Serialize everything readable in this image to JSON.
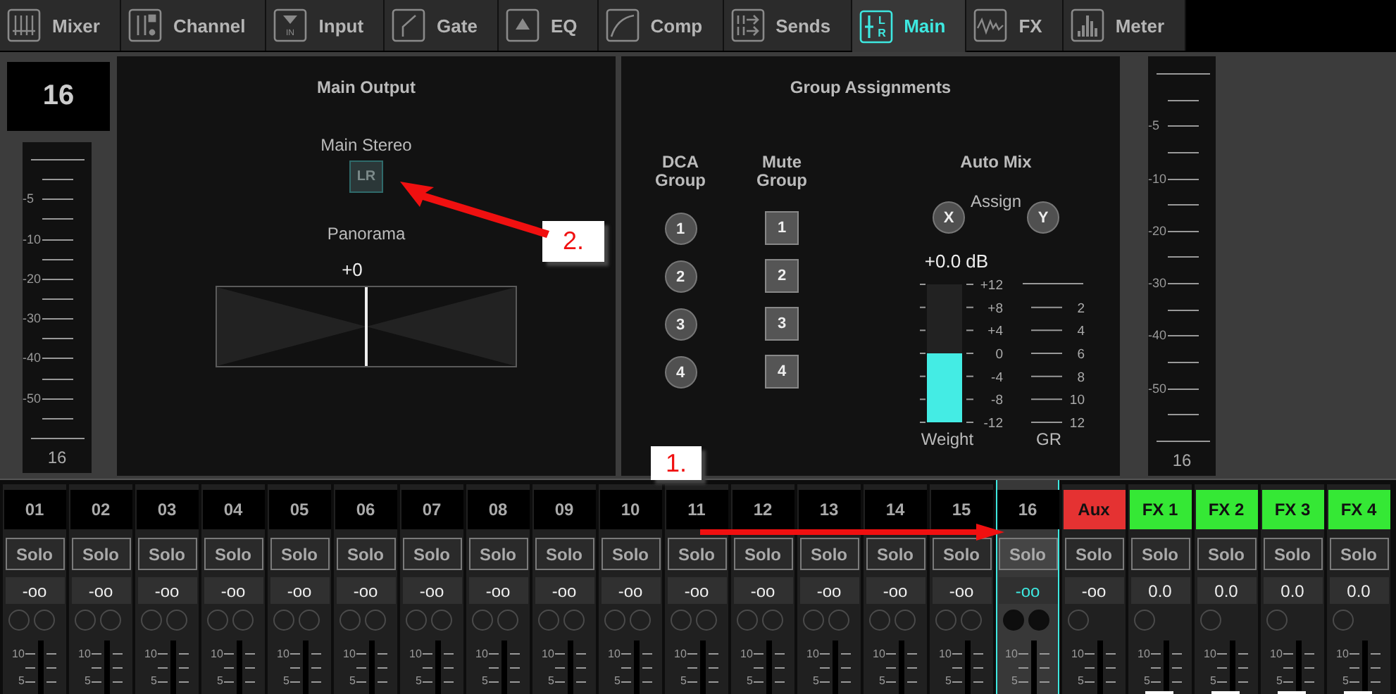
{
  "tabs": [
    {
      "label": "Mixer",
      "selected": false
    },
    {
      "label": "Channel",
      "selected": false
    },
    {
      "label": "Input",
      "selected": false,
      "icon_text": [
        "IN"
      ]
    },
    {
      "label": "Gate",
      "selected": false
    },
    {
      "label": "EQ",
      "selected": false
    },
    {
      "label": "Comp",
      "selected": false
    },
    {
      "label": "Sends",
      "selected": false
    },
    {
      "label": "Main",
      "selected": true,
      "icon_text": [
        "L",
        "R"
      ]
    },
    {
      "label": "FX",
      "selected": false
    },
    {
      "label": "Meter",
      "selected": false
    }
  ],
  "channel_display": "16",
  "left_meter": {
    "labels": [
      "-5",
      "-10",
      "-20",
      "-30",
      "-40",
      "-50"
    ],
    "channel": "16"
  },
  "main_output": {
    "title": "Main Output",
    "stereo_label": "Main Stereo",
    "stereo_button": {
      "label": "LR",
      "on": false
    },
    "panorama_label": "Panorama",
    "panorama_value": "+0",
    "panorama": {
      "level": 0.5
    }
  },
  "group_assignments": {
    "title": "Group Assignments",
    "dca": {
      "heading": "DCA Group",
      "buttons": [
        {
          "label": "1",
          "on": false
        },
        {
          "label": "2",
          "on": false
        },
        {
          "label": "3",
          "on": false
        },
        {
          "label": "4",
          "on": false
        }
      ]
    },
    "mute": {
      "heading": "Mute Group",
      "buttons": [
        {
          "label": "1",
          "on": false
        },
        {
          "label": "2",
          "on": false
        },
        {
          "label": "3",
          "on": false
        },
        {
          "label": "4",
          "on": false
        }
      ]
    },
    "auto_mix": {
      "heading": "Auto Mix",
      "assign_label": "Assign",
      "assign": [
        {
          "label": "X",
          "on": false
        },
        {
          "label": "Y",
          "on": false
        }
      ],
      "weight_value": "+0.0 dB",
      "weight": {
        "level": 0.5,
        "scale": [
          "+12",
          "+8",
          "+4",
          "0",
          "-4",
          "-8",
          "-12"
        ],
        "label": "Weight"
      },
      "gr": {
        "scale": [
          "2",
          "4",
          "6",
          "8",
          "10",
          "12"
        ],
        "label": "GR"
      }
    }
  },
  "right_meter": {
    "labels": [
      "-5",
      "-10",
      "-20",
      "-30",
      "-40",
      "-50"
    ],
    "channel": "16"
  },
  "strips": [
    {
      "name": "01",
      "kind": "channel",
      "selected": false,
      "solo": "Solo",
      "value": "-oo",
      "scale": [
        "10",
        "5"
      ]
    },
    {
      "name": "02",
      "kind": "channel",
      "selected": false,
      "solo": "Solo",
      "value": "-oo",
      "scale": [
        "10",
        "5"
      ]
    },
    {
      "name": "03",
      "kind": "channel",
      "selected": false,
      "solo": "Solo",
      "value": "-oo",
      "scale": [
        "10",
        "5"
      ]
    },
    {
      "name": "04",
      "kind": "channel",
      "selected": false,
      "solo": "Solo",
      "value": "-oo",
      "scale": [
        "10",
        "5"
      ]
    },
    {
      "name": "05",
      "kind": "channel",
      "selected": false,
      "solo": "Solo",
      "value": "-oo",
      "scale": [
        "10",
        "5"
      ]
    },
    {
      "name": "06",
      "kind": "channel",
      "selected": false,
      "solo": "Solo",
      "value": "-oo",
      "scale": [
        "10",
        "5"
      ]
    },
    {
      "name": "07",
      "kind": "channel",
      "selected": false,
      "solo": "Solo",
      "value": "-oo",
      "scale": [
        "10",
        "5"
      ]
    },
    {
      "name": "08",
      "kind": "channel",
      "selected": false,
      "solo": "Solo",
      "value": "-oo",
      "scale": [
        "10",
        "5"
      ]
    },
    {
      "name": "09",
      "kind": "channel",
      "selected": false,
      "solo": "Solo",
      "value": "-oo",
      "scale": [
        "10",
        "5"
      ]
    },
    {
      "name": "10",
      "kind": "channel",
      "selected": false,
      "solo": "Solo",
      "value": "-oo",
      "scale": [
        "10",
        "5"
      ]
    },
    {
      "name": "11",
      "kind": "channel",
      "selected": false,
      "solo": "Solo",
      "value": "-oo",
      "scale": [
        "10",
        "5"
      ]
    },
    {
      "name": "12",
      "kind": "channel",
      "selected": false,
      "solo": "Solo",
      "value": "-oo",
      "scale": [
        "10",
        "5"
      ]
    },
    {
      "name": "13",
      "kind": "channel",
      "selected": false,
      "solo": "Solo",
      "value": "-oo",
      "scale": [
        "10",
        "5"
      ]
    },
    {
      "name": "14",
      "kind": "channel",
      "selected": false,
      "solo": "Solo",
      "value": "-oo",
      "scale": [
        "10",
        "5"
      ]
    },
    {
      "name": "15",
      "kind": "channel",
      "selected": false,
      "solo": "Solo",
      "value": "-oo",
      "scale": [
        "10",
        "5"
      ]
    },
    {
      "name": "16",
      "kind": "channel",
      "selected": true,
      "solo": "Solo",
      "value": "-oo",
      "scale": [
        "10",
        "5"
      ]
    },
    {
      "name": "Aux",
      "kind": "aux",
      "color": "#e53232",
      "selected": false,
      "solo": "Solo",
      "value": "-oo",
      "scale": [
        "10",
        "5"
      ]
    },
    {
      "name": "FX 1",
      "kind": "fx",
      "color": "#35e835",
      "selected": false,
      "solo": "Solo",
      "value": "0.0",
      "scale": [
        "10",
        "5"
      ]
    },
    {
      "name": "FX 2",
      "kind": "fx",
      "color": "#35e835",
      "selected": false,
      "solo": "Solo",
      "value": "0.0",
      "scale": [
        "10",
        "5"
      ]
    },
    {
      "name": "FX 3",
      "kind": "fx",
      "color": "#35e835",
      "selected": false,
      "solo": "Solo",
      "value": "0.0",
      "scale": [
        "10",
        "5"
      ]
    },
    {
      "name": "FX 4",
      "kind": "fx",
      "color": "#35e835",
      "selected": false,
      "solo": "Solo",
      "value": "0.0",
      "scale": [
        "10",
        "5"
      ]
    }
  ],
  "annotations": [
    {
      "label": "2."
    },
    {
      "label": "1."
    }
  ]
}
